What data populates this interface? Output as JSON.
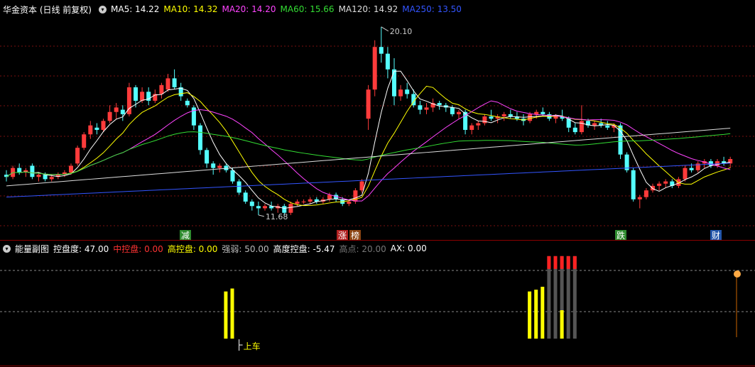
{
  "main": {
    "title": "华金资本 (日线 前复权)",
    "ma": [
      {
        "label": "MA5: 14.22",
        "color": "#ffffff"
      },
      {
        "label": "MA10: 14.32",
        "color": "#ffff00"
      },
      {
        "label": "MA20: 14.20",
        "color": "#ff44ff"
      },
      {
        "label": "MA60: 15.66",
        "color": "#33dd33"
      },
      {
        "label": "MA120: 14.92",
        "color": "#dddddd"
      },
      {
        "label": "MA250: 13.50",
        "color": "#3355ff"
      }
    ],
    "high_label": "20.10",
    "low_label": "11.68",
    "markers": [
      {
        "text": "减",
        "bg": "#2e8b2e",
        "color": "#ffffff"
      },
      {
        "text": "涨",
        "bg": "#b02020",
        "color": "#ffffff"
      },
      {
        "text": "榜",
        "bg": "#8b4513",
        "color": "#ffffff"
      },
      {
        "text": "跌",
        "bg": "#2e8b2e",
        "color": "#ffffff"
      },
      {
        "text": "财",
        "bg": "#2255aa",
        "color": "#ffffff"
      }
    ]
  },
  "sub": {
    "title": "能量副图",
    "items": [
      {
        "label": "控盘度: 47.00",
        "color": "#ffffff"
      },
      {
        "label": "中控盘: 0.00",
        "color": "#ff3333"
      },
      {
        "label": "高控盘: 0.00",
        "color": "#ffff00"
      },
      {
        "label": "强弱: 50.00",
        "color": "#bbbbbb"
      },
      {
        "label": "高度控盘: -5.47",
        "color": "#ffffff"
      },
      {
        "label": "高点: 20.00",
        "color": "#777777"
      },
      {
        "label": "AX: 0.00",
        "color": "#ffffff"
      }
    ],
    "signal_label": "上车"
  },
  "chart_data": {
    "type": "candlestick",
    "ohlc": [
      [
        13.5,
        13.7,
        13.2,
        13.4
      ],
      [
        13.4,
        13.9,
        13.3,
        13.8
      ],
      [
        13.8,
        14.0,
        13.5,
        13.6
      ],
      [
        13.6,
        13.8,
        13.4,
        13.7
      ],
      [
        13.9,
        14.0,
        13.3,
        13.4
      ],
      [
        13.4,
        13.6,
        13.2,
        13.5
      ],
      [
        13.5,
        13.6,
        13.2,
        13.3
      ],
      [
        13.3,
        13.5,
        13.2,
        13.4
      ],
      [
        13.4,
        13.6,
        13.3,
        13.5
      ],
      [
        13.5,
        13.7,
        13.4,
        13.6
      ],
      [
        13.6,
        14.0,
        13.5,
        13.9
      ],
      [
        14.0,
        14.8,
        13.9,
        14.7
      ],
      [
        14.7,
        15.4,
        14.6,
        15.3
      ],
      [
        15.3,
        15.9,
        15.1,
        15.7
      ],
      [
        15.6,
        15.8,
        15.3,
        15.5
      ],
      [
        15.5,
        16.0,
        15.4,
        15.9
      ],
      [
        15.9,
        16.6,
        15.8,
        16.3
      ],
      [
        16.3,
        16.7,
        16.0,
        16.5
      ],
      [
        16.4,
        16.6,
        15.9,
        16.2
      ],
      [
        16.2,
        17.6,
        16.1,
        17.4
      ],
      [
        17.4,
        17.5,
        16.5,
        16.8
      ],
      [
        16.8,
        17.4,
        16.7,
        17.2
      ],
      [
        17.2,
        17.4,
        16.6,
        16.8
      ],
      [
        16.8,
        17.3,
        16.7,
        17.1
      ],
      [
        17.1,
        17.6,
        16.9,
        17.5
      ],
      [
        17.3,
        18.0,
        17.2,
        17.8
      ],
      [
        17.8,
        18.2,
        17.3,
        17.4
      ],
      [
        17.4,
        17.6,
        16.8,
        17.0
      ],
      [
        16.8,
        16.9,
        16.5,
        16.6
      ],
      [
        16.5,
        16.6,
        15.5,
        15.7
      ],
      [
        15.7,
        15.8,
        14.4,
        14.6
      ],
      [
        14.6,
        14.7,
        13.8,
        14.0
      ],
      [
        14.0,
        14.1,
        13.5,
        13.8
      ],
      [
        13.8,
        14.0,
        13.6,
        13.9
      ],
      [
        13.9,
        14.0,
        13.6,
        13.7
      ],
      [
        13.7,
        13.8,
        13.1,
        13.2
      ],
      [
        13.2,
        13.3,
        12.6,
        12.7
      ],
      [
        12.7,
        12.8,
        12.2,
        12.3
      ],
      [
        12.3,
        12.4,
        11.9,
        12.1
      ],
      [
        12.1,
        12.3,
        11.7,
        12.0
      ],
      [
        12.0,
        12.2,
        11.9,
        12.1
      ],
      [
        12.1,
        12.3,
        11.9,
        12.0
      ],
      [
        12.0,
        12.2,
        11.8,
        12.1
      ],
      [
        12.1,
        12.2,
        11.7,
        11.8
      ],
      [
        11.8,
        12.3,
        11.7,
        12.2
      ],
      [
        12.2,
        12.4,
        12.1,
        12.3
      ],
      [
        12.3,
        12.4,
        12.2,
        12.3
      ],
      [
        12.3,
        12.5,
        12.2,
        12.4
      ],
      [
        12.4,
        12.5,
        12.2,
        12.3
      ],
      [
        12.3,
        12.5,
        12.2,
        12.4
      ],
      [
        12.4,
        12.7,
        12.3,
        12.6
      ],
      [
        12.6,
        12.7,
        12.3,
        12.4
      ],
      [
        12.4,
        12.5,
        12.1,
        12.2
      ],
      [
        12.2,
        12.4,
        12.1,
        12.3
      ],
      [
        12.3,
        12.9,
        12.2,
        12.8
      ],
      [
        12.8,
        13.3,
        12.7,
        13.2
      ],
      [
        16.0,
        17.5,
        15.5,
        17.3
      ],
      [
        17.3,
        19.5,
        17.0,
        19.2
      ],
      [
        19.2,
        20.1,
        18.5,
        18.9
      ],
      [
        18.9,
        19.2,
        17.8,
        18.2
      ],
      [
        18.2,
        18.7,
        16.6,
        17.0
      ],
      [
        17.0,
        17.5,
        16.8,
        17.3
      ],
      [
        17.3,
        17.6,
        16.9,
        17.1
      ],
      [
        17.1,
        17.3,
        16.5,
        16.6
      ],
      [
        16.6,
        16.8,
        16.2,
        16.4
      ],
      [
        16.4,
        16.7,
        16.2,
        16.5
      ],
      [
        16.5,
        16.9,
        16.3,
        16.7
      ],
      [
        16.7,
        16.8,
        16.4,
        16.6
      ],
      [
        16.6,
        16.7,
        16.3,
        16.5
      ],
      [
        16.5,
        16.6,
        16.1,
        16.2
      ],
      [
        16.2,
        16.4,
        16.0,
        16.3
      ],
      [
        16.3,
        16.4,
        15.3,
        15.5
      ],
      [
        15.5,
        15.8,
        15.3,
        15.7
      ],
      [
        15.7,
        15.9,
        15.5,
        15.8
      ],
      [
        15.8,
        16.2,
        15.7,
        16.1
      ],
      [
        16.1,
        16.4,
        15.9,
        16.0
      ],
      [
        16.0,
        16.2,
        15.8,
        16.1
      ],
      [
        16.1,
        16.3,
        15.9,
        16.2
      ],
      [
        16.2,
        16.4,
        16.0,
        16.1
      ],
      [
        16.1,
        16.3,
        15.9,
        16.0
      ],
      [
        16.0,
        16.2,
        15.7,
        15.9
      ],
      [
        15.9,
        16.3,
        15.8,
        16.2
      ],
      [
        16.2,
        16.4,
        16.0,
        16.3
      ],
      [
        16.3,
        16.5,
        16.1,
        16.2
      ],
      [
        16.2,
        16.3,
        15.9,
        16.0
      ],
      [
        16.0,
        16.2,
        15.8,
        16.1
      ],
      [
        16.1,
        16.4,
        15.9,
        16.0
      ],
      [
        16.0,
        16.1,
        15.4,
        15.6
      ],
      [
        15.6,
        15.8,
        15.3,
        15.4
      ],
      [
        15.4,
        16.6,
        15.3,
        15.9
      ],
      [
        15.9,
        16.0,
        15.6,
        15.7
      ],
      [
        15.7,
        15.9,
        15.5,
        15.8
      ],
      [
        15.8,
        16.0,
        15.6,
        15.7
      ],
      [
        15.7,
        15.9,
        15.5,
        15.6
      ],
      [
        15.6,
        15.8,
        15.4,
        15.7
      ],
      [
        15.7,
        15.8,
        14.2,
        14.4
      ],
      [
        14.4,
        14.5,
        13.6,
        13.7
      ],
      [
        13.7,
        13.8,
        12.3,
        12.4
      ],
      [
        12.4,
        12.6,
        12.0,
        12.5
      ],
      [
        12.5,
        12.9,
        12.4,
        12.8
      ],
      [
        12.8,
        13.1,
        12.7,
        13.0
      ],
      [
        13.0,
        13.2,
        12.8,
        13.1
      ],
      [
        13.1,
        13.3,
        12.9,
        13.2
      ],
      [
        13.2,
        13.3,
        12.9,
        13.0
      ],
      [
        13.0,
        13.4,
        12.9,
        13.3
      ],
      [
        13.3,
        13.9,
        13.2,
        13.8
      ],
      [
        13.8,
        14.0,
        13.6,
        13.7
      ],
      [
        13.7,
        14.1,
        13.6,
        14.0
      ],
      [
        14.0,
        14.2,
        13.8,
        14.1
      ],
      [
        14.1,
        14.2,
        13.8,
        13.9
      ],
      [
        13.9,
        14.2,
        13.8,
        14.1
      ],
      [
        14.1,
        14.3,
        13.9,
        14.0
      ],
      [
        14.0,
        14.3,
        13.8,
        14.2
      ]
    ],
    "ylim": [
      11.0,
      20.6
    ],
    "sub_bars": [
      {
        "index": 34,
        "value": 80,
        "color": "#ffff00"
      },
      {
        "index": 35,
        "value": 85,
        "color": "#ffff00"
      },
      {
        "index": 81,
        "value": 80,
        "color": "#ffff00"
      },
      {
        "index": 82,
        "value": 83,
        "color": "#ffff00"
      },
      {
        "index": 83,
        "value": 88,
        "color": "#ffff00"
      },
      {
        "index": 84,
        "value": 140,
        "color": "#555555",
        "cap": "#ff2222"
      },
      {
        "index": 85,
        "value": 140,
        "color": "#555555",
        "cap": "#ff2222"
      },
      {
        "index": 86,
        "value": 140,
        "color": "#555555",
        "cap": "#ff2222"
      },
      {
        "index": 87,
        "value": 140,
        "color": "#555555",
        "cap": "#ff2222"
      },
      {
        "index": 88,
        "value": 140,
        "color": "#555555",
        "cap": "#ff2222"
      }
    ]
  }
}
